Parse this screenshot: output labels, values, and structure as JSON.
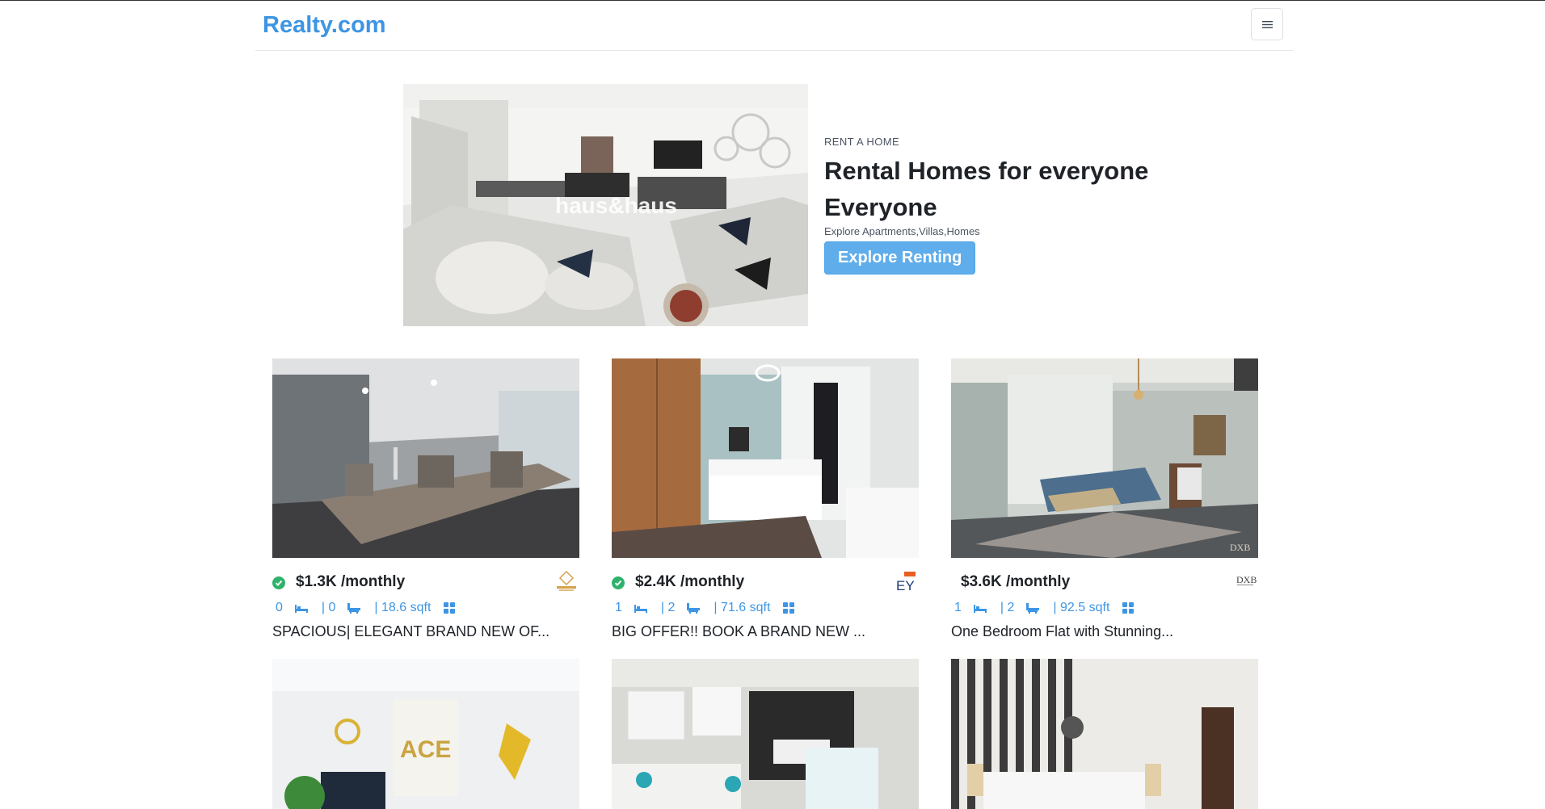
{
  "brand": "Realty.com",
  "nav": {
    "menu_icon": "hamburger-menu-icon"
  },
  "hero": {
    "eyebrow": "RENT A HOME",
    "title_line1": "Rental Homes for everyone",
    "title_line2": "Everyone",
    "subtitle": "Explore Apartments,Villas,Homes",
    "cta": "Explore Renting",
    "image_watermark": "haus&haus"
  },
  "listings": [
    {
      "price": "$1.3K /monthly",
      "verified": true,
      "beds": "0",
      "baths": "| 0",
      "area": "| 18.6 sqft",
      "title": "SPACIOUS| ELEGANT BRAND NEW OF...",
      "agent_logo": "dean-star-logo"
    },
    {
      "price": "$2.4K /monthly",
      "verified": true,
      "beds": "1",
      "baths": "| 2",
      "area": "| 71.6 sqft",
      "title": "BIG OFFER!! BOOK A BRAND NEW ...",
      "agent_logo": "ey-logo"
    },
    {
      "price": "$3.6K /monthly",
      "verified": false,
      "beds": "1",
      "baths": "| 2",
      "area": "| 92.5 sqft",
      "title": "One Bedroom Flat with Stunning...",
      "agent_logo": "dxb-logo"
    }
  ],
  "second_row_images": [
    {
      "watermark": "ACE"
    },
    {
      "watermark": ""
    },
    {
      "watermark": ""
    }
  ],
  "colors": {
    "brand": "#3d95e3",
    "cta": "#5fadea",
    "verified": "#2fb36b"
  }
}
